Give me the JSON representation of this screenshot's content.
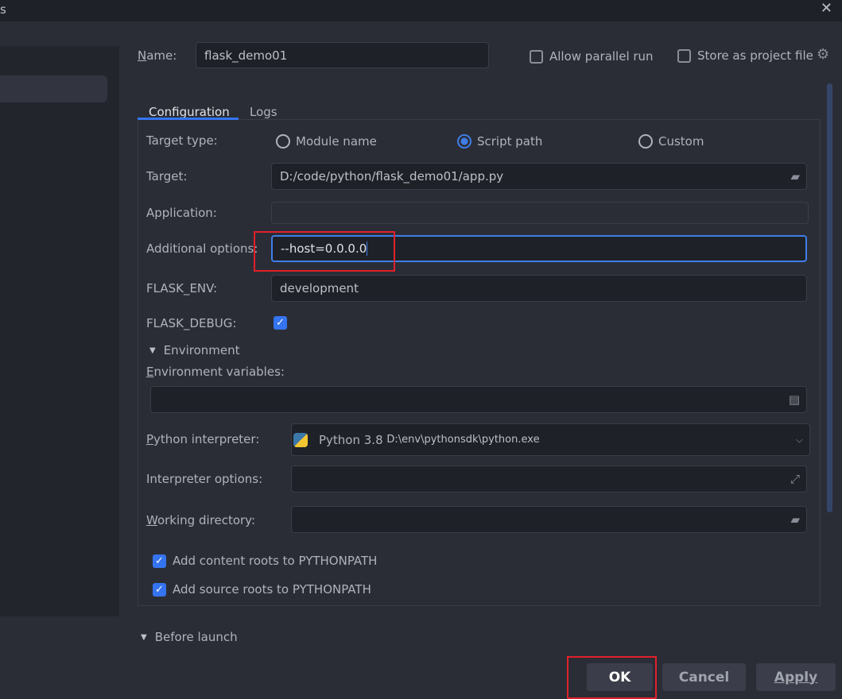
{
  "window": {
    "title_fragment": "s",
    "close": "✕"
  },
  "name": {
    "label": "Name:",
    "value": "flask_demo01"
  },
  "options": {
    "allow_parallel": {
      "label": "Allow parallel run",
      "checked": false
    },
    "store_project": {
      "label": "Store as project file",
      "checked": false
    }
  },
  "tabs": [
    {
      "label": "Configuration",
      "active": true
    },
    {
      "label": "Logs",
      "active": false
    }
  ],
  "target_type": {
    "label": "Target type:",
    "options": [
      {
        "label": "Module name",
        "selected": false
      },
      {
        "label": "Script path",
        "selected": true
      },
      {
        "label": "Custom",
        "selected": false
      }
    ]
  },
  "target": {
    "label": "Target:",
    "value": "D:/code/python/flask_demo01/app.py"
  },
  "application": {
    "label": "Application:",
    "value": ""
  },
  "additional": {
    "label": "Additional options:",
    "value": "--host=0.0.0.0"
  },
  "flask_env": {
    "label": "FLASK_ENV:",
    "value": "development"
  },
  "flask_debug": {
    "label": "FLASK_DEBUG:",
    "checked": true
  },
  "environment": {
    "label": "Environment",
    "env_vars_label": "Environment variables:",
    "env_vars_value": ""
  },
  "interpreter": {
    "label": "Python interpreter:",
    "name": "Python 3.8",
    "path": "D:\\env\\pythonsdk\\python.exe"
  },
  "interp_options": {
    "label": "Interpreter options:",
    "value": ""
  },
  "working_dir": {
    "label": "Working directory:",
    "value": ""
  },
  "content_roots": {
    "label": "Add content roots to PYTHONPATH",
    "checked": true
  },
  "source_roots": {
    "label": "Add source roots to PYTHONPATH",
    "checked": true
  },
  "before_launch": {
    "label": "Before launch"
  },
  "buttons": {
    "ok": "OK",
    "cancel": "Cancel",
    "apply": "Apply"
  },
  "colors": {
    "accent": "#3574f0",
    "highlight": "#e0202a",
    "background": "#2b2d36"
  }
}
